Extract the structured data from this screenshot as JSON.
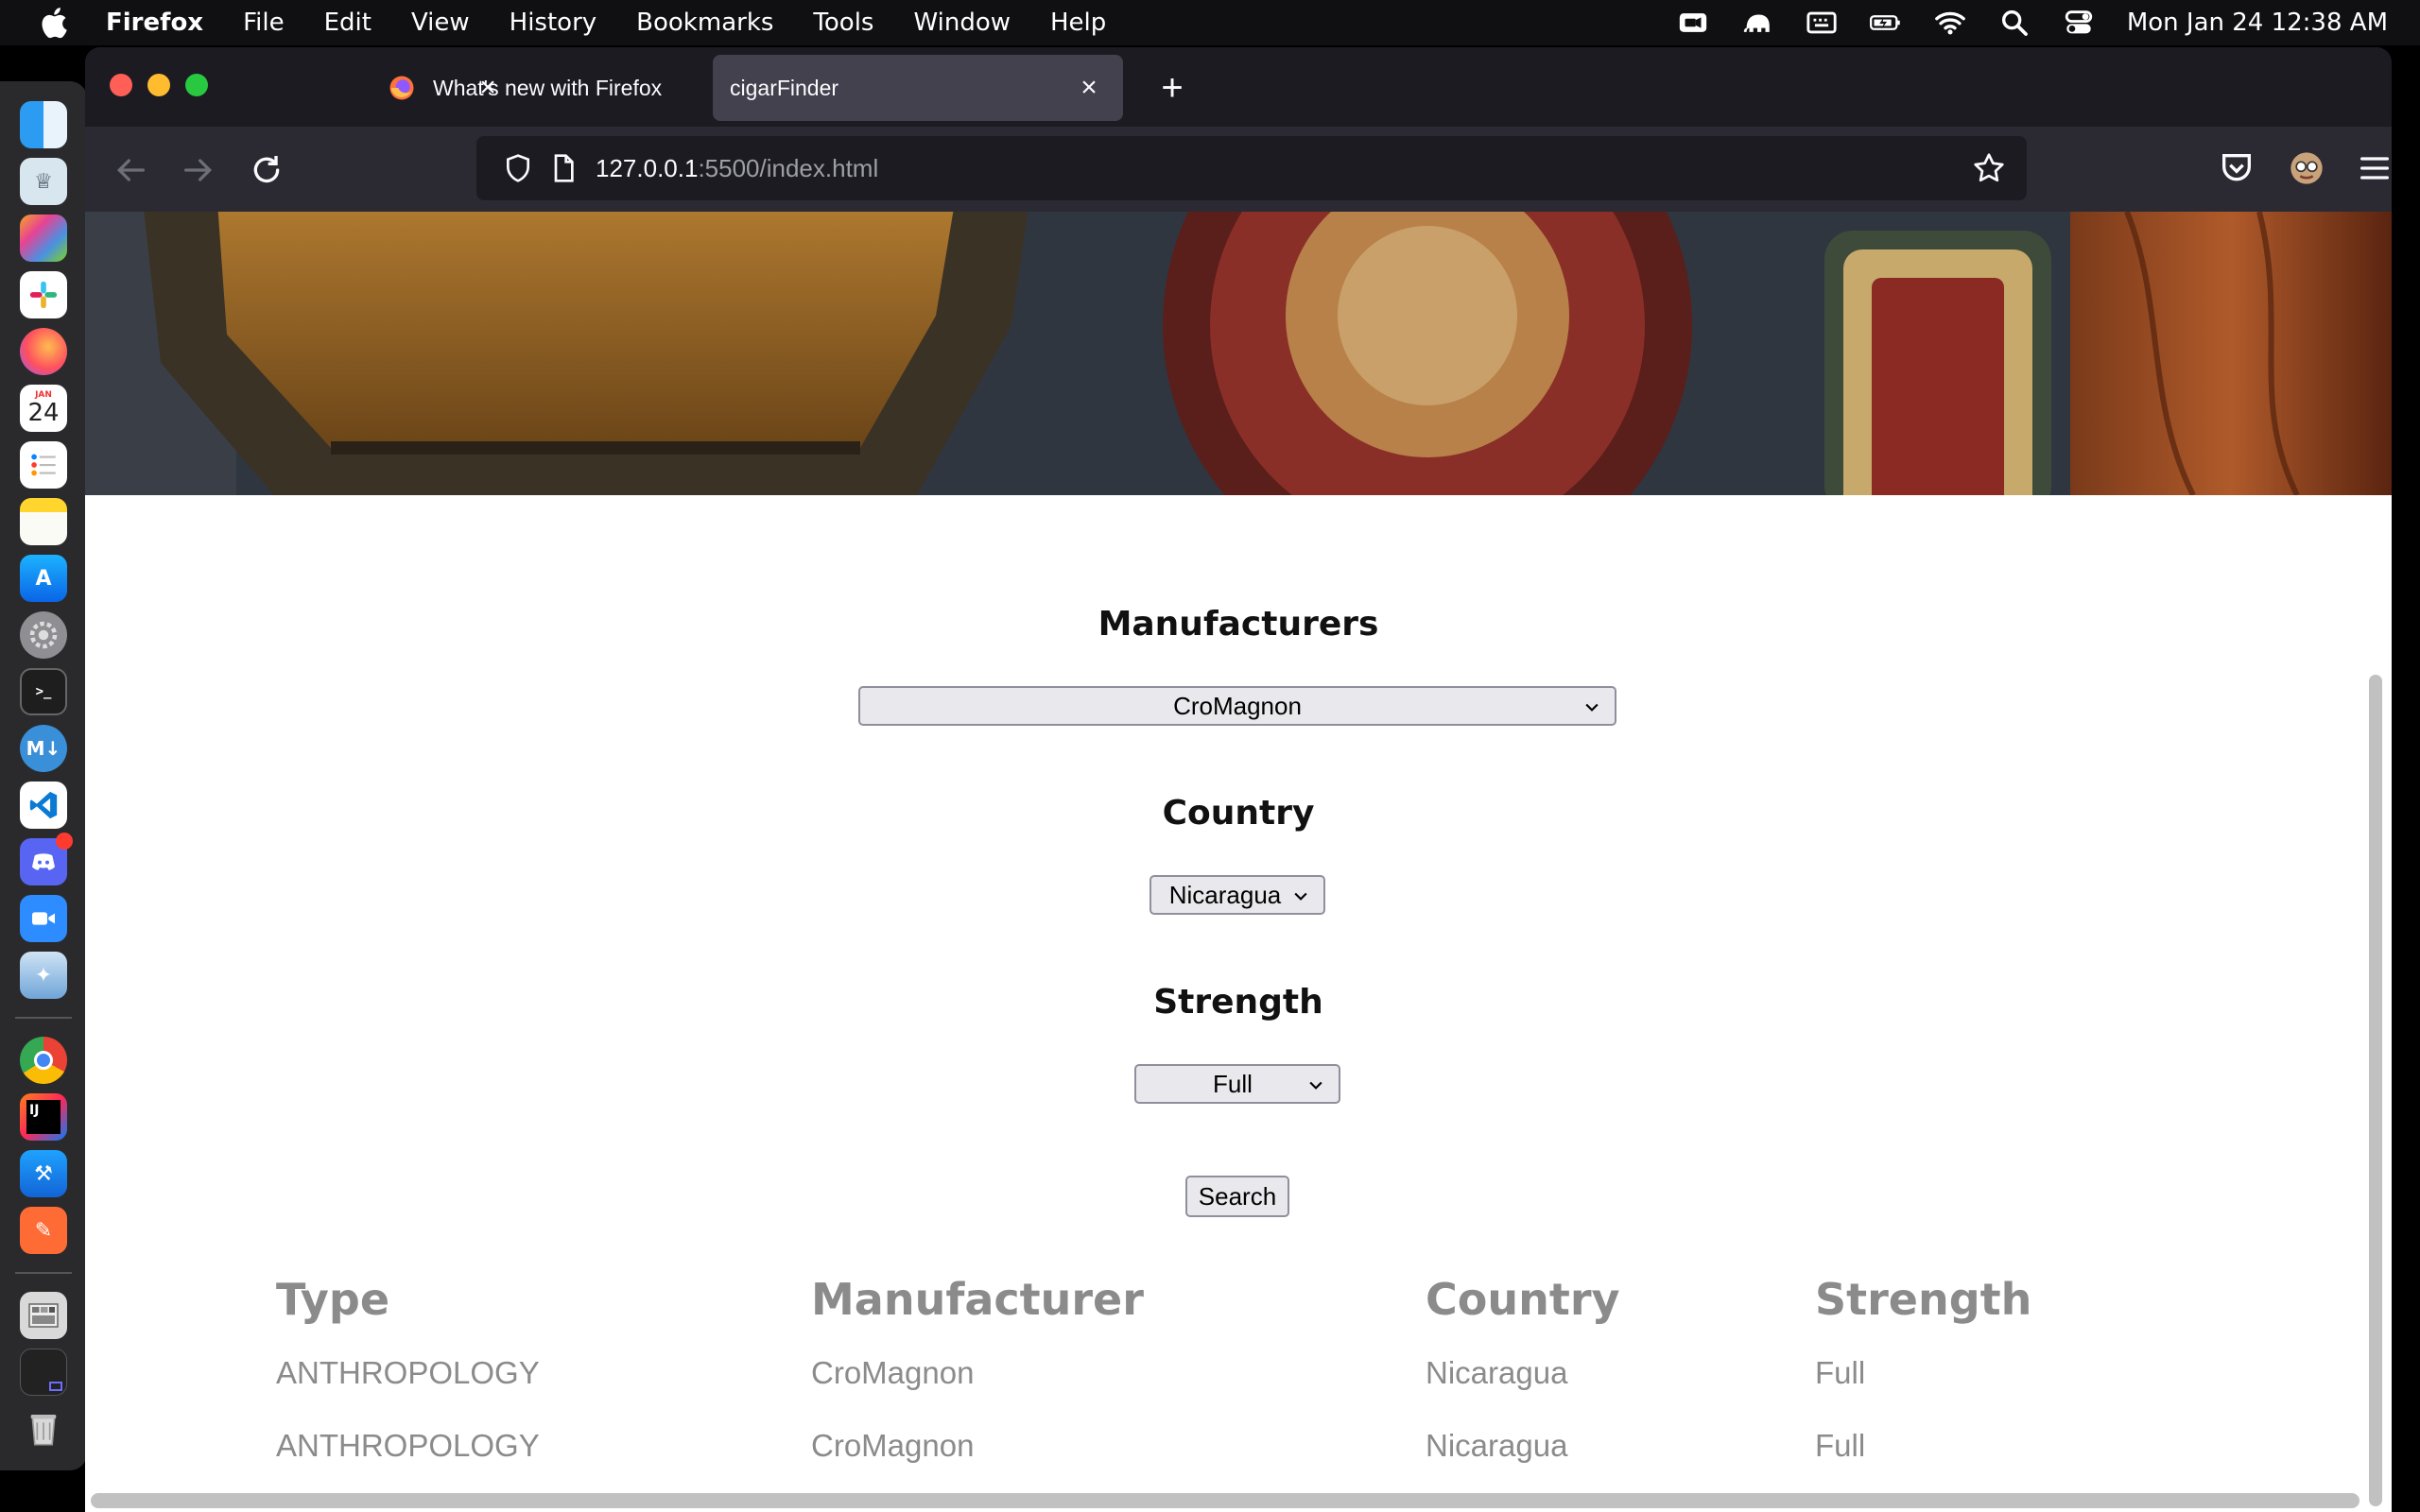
{
  "menubar": {
    "app_name": "Firefox",
    "menus": [
      "File",
      "Edit",
      "View",
      "History",
      "Bookmarks",
      "Tools",
      "Window",
      "Help"
    ],
    "status_icons": [
      "camera-icon",
      "elephant-icon",
      "keyboard-icon",
      "battery-icon",
      "wifi-icon",
      "spotlight-icon",
      "control-center-icon"
    ],
    "clock": "Mon Jan 24  12:38 AM"
  },
  "dock": {
    "apps": [
      "finder",
      "cyberduck",
      "launchpad",
      "slack",
      "firefox",
      "calendar",
      "reminders",
      "notes",
      "app-store",
      "system-preferences",
      "terminal",
      "markdown-editor",
      "vscode",
      "discord",
      "zoom",
      "xcode-instruments",
      "chrome",
      "intellij",
      "xcode",
      "sketch-tool",
      "photos-preview",
      "screen-preview",
      "trash"
    ],
    "calendar_month": "JAN",
    "calendar_day": "24"
  },
  "browser": {
    "tabs": [
      {
        "title": "What's new with Firefox"
      },
      {
        "title": "cigarFinder"
      }
    ],
    "url_host": "127.0.0.1",
    "url_path": ":5500/index.html"
  },
  "page": {
    "manufacturers_heading": "Manufacturers",
    "manufacturer_selected": "CroMagnon",
    "country_heading": "Country",
    "country_selected": "Nicaragua",
    "strength_heading": "Strength",
    "strength_selected": "Full",
    "search_label": "Search",
    "table": {
      "headers": [
        "Type",
        "Manufacturer",
        "Country",
        "Strength"
      ],
      "rows": [
        [
          "ANTHROPOLOGY",
          "CroMagnon",
          "Nicaragua",
          "Full"
        ],
        [
          "ANTHROPOLOGY",
          "CroMagnon",
          "Nicaragua",
          "Full"
        ]
      ]
    }
  },
  "colors": {
    "menubar_bg": "#101013",
    "tab_active_bg": "#42414d",
    "toolbar_bg": "#2b2a33",
    "table_text": "#8b8b8b"
  }
}
